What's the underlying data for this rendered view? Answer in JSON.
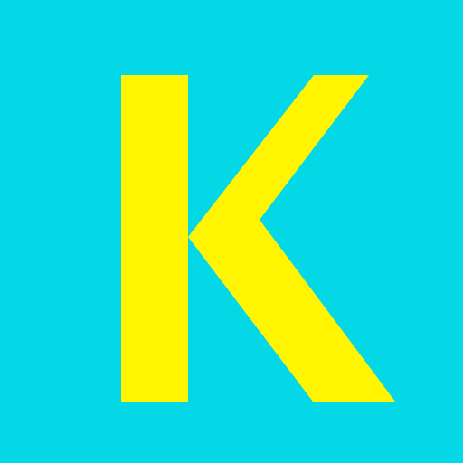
{
  "letter": "K",
  "colors": {
    "background": "#04d8e6",
    "letter": "#fff500"
  }
}
